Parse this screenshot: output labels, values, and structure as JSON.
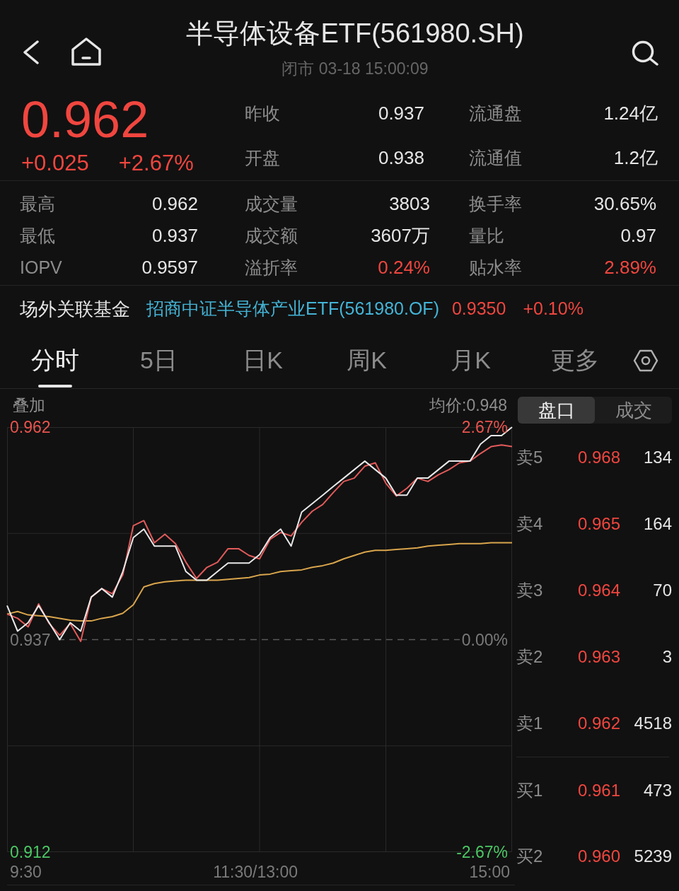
{
  "header": {
    "title": "半导体设备ETF(561980.SH)",
    "subtitle": "闭市 03-18 15:00:09"
  },
  "quote": {
    "price": "0.962",
    "change": "+0.025",
    "change_percent": "+2.67%",
    "rising": true,
    "fields": [
      {
        "label": "昨收",
        "value": "0.937"
      },
      {
        "label": "流通盘",
        "value": "1.24亿"
      },
      {
        "label": "开盘",
        "value": "0.938"
      },
      {
        "label": "流通值",
        "value": "1.2亿"
      }
    ]
  },
  "stats": [
    {
      "label": "最高",
      "value": "0.962",
      "color": "#e6e6e6"
    },
    {
      "label": "成交量",
      "value": "3803",
      "color": "#e6e6e6"
    },
    {
      "label": "换手率",
      "value": "30.65%",
      "color": "#e6e6e6"
    },
    {
      "label": "最低",
      "value": "0.937",
      "color": "#e6e6e6"
    },
    {
      "label": "成交额",
      "value": "3607万",
      "color": "#e6e6e6"
    },
    {
      "label": "量比",
      "value": "0.97",
      "color": "#e6e6e6"
    },
    {
      "label": "IOPV",
      "value": "0.9597",
      "color": "#e6e6e6"
    },
    {
      "label": "溢折率",
      "value": "0.24%",
      "color": "#f0463f"
    },
    {
      "label": "贴水率",
      "value": "2.89%",
      "color": "#f0463f"
    }
  ],
  "linked_fund": {
    "label": "场外关联基金",
    "name": "招商中证半导体产业ETF(561980.OF)",
    "price": "0.9350",
    "change": "+0.10%",
    "rising": true
  },
  "tabs": [
    {
      "label": "分时",
      "selected": true
    },
    {
      "label": "5日",
      "selected": false
    },
    {
      "label": "日K",
      "selected": false
    },
    {
      "label": "周K",
      "selected": false
    },
    {
      "label": "月K",
      "selected": false
    },
    {
      "label": "更多",
      "selected": false
    }
  ],
  "intraday": {
    "overlay_label": "叠加",
    "average_price": "均价:0.948",
    "chart_data": {
      "type": "line",
      "grid": true,
      "ylim": [
        0.912,
        0.962
      ],
      "yticks": [
        {
          "value": 0.962,
          "label": "0.962"
        },
        {
          "value": 0.937,
          "label": "0.937"
        },
        {
          "value": 0.912,
          "label": "0.912"
        }
      ],
      "series": [
        {
          "color": "#d9a54c",
          "values": [
            0.94,
            0.9403,
            0.9399,
            0.9398,
            0.9397,
            0.9395,
            0.9393,
            0.9392,
            0.9392,
            0.9395,
            0.9397,
            0.9401,
            0.9411,
            0.9432,
            0.9436,
            0.9438,
            0.9439,
            0.944,
            0.944,
            0.944,
            0.944,
            0.9441,
            0.9442,
            0.9443,
            0.9446,
            0.9447,
            0.945,
            0.9451,
            0.9452,
            0.9455,
            0.9457,
            0.946,
            0.9465,
            0.9469,
            0.9473,
            0.9475,
            0.9475,
            0.9476,
            0.9477,
            0.9478,
            0.948,
            0.9481,
            0.9482,
            0.9483,
            0.9483,
            0.9483,
            0.9484,
            0.9484,
            0.9484
          ]
        },
        {
          "color": "#e25a5a",
          "values": [
            0.94,
            0.9395,
            0.9385,
            0.9412,
            0.9389,
            0.9375,
            0.9389,
            0.9368,
            0.942,
            0.943,
            0.9424,
            0.9446,
            0.9504,
            0.951,
            0.9484,
            0.9494,
            0.9483,
            0.9461,
            0.9442,
            0.9455,
            0.9461,
            0.9477,
            0.9477,
            0.9469,
            0.9465,
            0.9488,
            0.9496,
            0.9492,
            0.9508,
            0.9521,
            0.9529,
            0.9543,
            0.9556,
            0.956,
            0.9574,
            0.9578,
            0.9554,
            0.9539,
            0.9548,
            0.956,
            0.9556,
            0.9564,
            0.957,
            0.9578,
            0.958,
            0.9589,
            0.9597,
            0.9599,
            0.9597
          ]
        },
        {
          "color": "#e8e8e8",
          "values": [
            0.941,
            0.938,
            0.939,
            0.941,
            0.939,
            0.937,
            0.939,
            0.938,
            0.942,
            0.943,
            0.942,
            0.945,
            0.949,
            0.95,
            0.948,
            0.948,
            0.948,
            0.945,
            0.944,
            0.944,
            0.945,
            0.946,
            0.946,
            0.946,
            0.947,
            0.949,
            0.95,
            0.948,
            0.952,
            0.953,
            0.954,
            0.955,
            0.956,
            0.957,
            0.958,
            0.957,
            0.956,
            0.954,
            0.954,
            0.956,
            0.956,
            0.957,
            0.958,
            0.958,
            0.958,
            0.96,
            0.961,
            0.961,
            0.962
          ]
        }
      ]
    },
    "right_ticks": [
      "2.67%",
      "0.00%",
      "-2.67%"
    ],
    "time_labels": [
      "9:30",
      "11:30/13:00",
      "15:00"
    ]
  },
  "order_book": {
    "tabs": [
      {
        "label": "盘口",
        "selected": true
      },
      {
        "label": "成交",
        "selected": false
      }
    ],
    "asks": [
      {
        "label": "卖5",
        "price": "0.968",
        "volume": "134"
      },
      {
        "label": "卖4",
        "price": "0.965",
        "volume": "164"
      },
      {
        "label": "卖3",
        "price": "0.964",
        "volume": "70"
      },
      {
        "label": "卖2",
        "price": "0.963",
        "volume": "3"
      },
      {
        "label": "卖1",
        "price": "0.962",
        "volume": "4518"
      }
    ],
    "bids": [
      {
        "label": "买1",
        "price": "0.961",
        "volume": "473"
      },
      {
        "label": "买2",
        "price": "0.960",
        "volume": "5239"
      }
    ]
  }
}
